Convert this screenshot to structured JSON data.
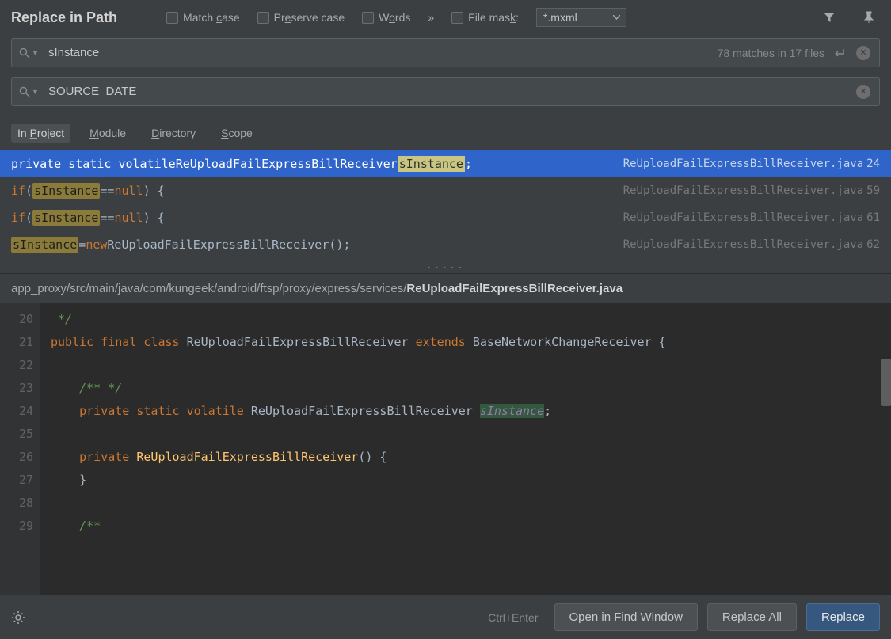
{
  "title": "Replace in Path",
  "options": {
    "match_case": "Match case",
    "preserve_case": "Preserve case",
    "words": "Words",
    "file_mask": "File mask:",
    "mask_value": "*.mxml"
  },
  "search": {
    "value": "sInstance",
    "status": "78 matches in 17 files"
  },
  "replace": {
    "value": "SOURCE_DATE"
  },
  "scopes": {
    "project": "In Project",
    "module": "Module",
    "directory": "Directory",
    "scope": "Scope"
  },
  "results": [
    {
      "prefix": "private static volatile ",
      "cls": "ReUploadFailExpressBillReceiver ",
      "match": "sInstance",
      "suffix": ";",
      "file": "ReUploadFailExpressBillReceiver.java",
      "line": "24",
      "selected": true
    },
    {
      "pre_kw": "if",
      "pre_txt": " (",
      "match": "sInstance",
      "mid_txt": " == ",
      "mid_kw": "null",
      "suffix": ") {",
      "file": "ReUploadFailExpressBillReceiver.java",
      "line": "59"
    },
    {
      "pre_kw": "if",
      "pre_txt": " (",
      "match": "sInstance",
      "mid_txt": " == ",
      "mid_kw": "null",
      "suffix": ") {",
      "file": "ReUploadFailExpressBillReceiver.java",
      "line": "61"
    },
    {
      "match": "sInstance",
      "mid_txt": " = ",
      "mid_kw": "new",
      "cls": " ReUploadFailExpressBillReceiver();",
      "file": "ReUploadFailExpressBillReceiver.java",
      "line": "62"
    }
  ],
  "path": {
    "dir": "app_proxy/src/main/java/com/kungeek/android/ftsp/proxy/express/services/",
    "file": "ReUploadFailExpressBillReceiver.java"
  },
  "editor_lines": [
    "20",
    "21",
    "22",
    "23",
    "24",
    "25",
    "26",
    "27",
    "28",
    "29"
  ],
  "editor": {
    "l20": " */",
    "l21a": "public final class",
    "l21b": " ReUploadFailExpressBillReceiver ",
    "l21c": "extends",
    "l21d": " BaseNetworkChangeReceiver {",
    "l23": "    /** */",
    "l24a": "    private static volatile",
    "l24b": " ReUploadFailExpressBillReceiver ",
    "l24c": "sInstance",
    "l24d": ";",
    "l26a": "    private",
    "l26b": " ReUploadFailExpressBillReceiver",
    "l26c": "() {",
    "l27": "    }",
    "l29": "    /**"
  },
  "bottom": {
    "hint": "Ctrl+Enter",
    "open": "Open in Find Window",
    "replace_all": "Replace All",
    "replace": "Replace"
  }
}
